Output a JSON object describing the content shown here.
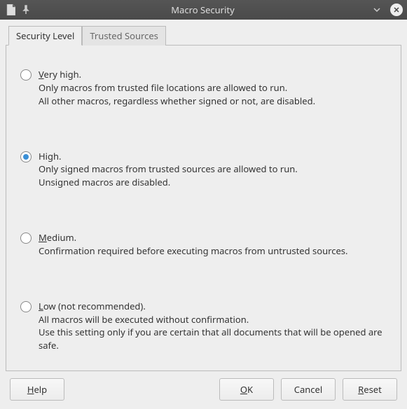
{
  "window": {
    "title": "Macro Security"
  },
  "tabs": {
    "security_level": "Security Level",
    "trusted_sources": "Trusted Sources"
  },
  "options": {
    "very_high": {
      "title_prefix": "V",
      "title_rest": "ery high.",
      "line2": "Only macros from trusted file locations are allowed to run.",
      "line3": "All other macros, regardless whether signed or not, are disabled."
    },
    "high": {
      "title": "High.",
      "line2": "Only signed macros from trusted sources are allowed to run.",
      "line3": "Unsigned macros are disabled."
    },
    "medium": {
      "title_prefix": "M",
      "title_rest": "edium.",
      "line2": "Confirmation required before executing macros from untrusted sources."
    },
    "low": {
      "title_prefix": "L",
      "title_rest": "ow (not recommended).",
      "line2": "All macros will be executed without confirmation.",
      "line3": "Use this setting only if you are certain that all documents that will be opened are safe."
    }
  },
  "buttons": {
    "help_prefix": "H",
    "help_rest": "elp",
    "ok_prefix": "O",
    "ok_rest": "K",
    "cancel": "Cancel",
    "reset_prefix": "R",
    "reset_rest": "eset"
  }
}
